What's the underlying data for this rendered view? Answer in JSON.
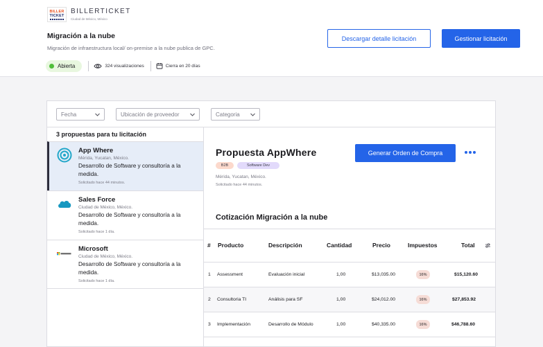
{
  "brand": {
    "logo_line1": "BILLER",
    "logo_line2": "TICKET",
    "name": "BILLERTICKET",
    "location": "Ciudad de México, México"
  },
  "header": {
    "title": "Migración a la nube",
    "subtitle": "Migración de infraestructura local/ on-premise a la nube publica de GPC.",
    "status": "Abierta",
    "views": "324 visualizaciones",
    "closes": "Cierra en 20 días",
    "download_label": "Descargar detalle licitación",
    "manage_label": "Gestionar licitación"
  },
  "colors": {
    "accent": "#2464e8",
    "status_green": "#4fbe3a",
    "selected_bg": "#e6edf8"
  },
  "filters": [
    {
      "label": "Fecha",
      "icon": "chevron-down-icon"
    },
    {
      "label": "Ubicación de proveedor",
      "icon": "chevron-down-icon"
    },
    {
      "label": "Categoria",
      "icon": "chevron-down-icon"
    }
  ],
  "proposals": {
    "title": "3 propuestas para tu licitación",
    "items": [
      {
        "name": "App Where",
        "location": "Mérida, Yucatan, México.",
        "description": "Desarrollo de Software y consultoría a la medida.",
        "requested": "Solicitado hace 44 minutos.",
        "icon": "appwhere-logo",
        "selected": true
      },
      {
        "name": "Sales Force",
        "location": "Ciudad de México, México.",
        "description": "Desarrollo de Software y consultoría a la medida.",
        "requested": "Solicitado hace 1 día.",
        "icon": "salesforce-logo",
        "selected": false
      },
      {
        "name": "Microsoft",
        "location": "Ciudad de México, México.",
        "description": "Desarrollo de Software y consultoría a la medida.",
        "requested": "Solicitado hace 1 día.",
        "icon": "microsoft-logo",
        "selected": false
      }
    ]
  },
  "detail": {
    "title": "Propuesta AppWhere",
    "tags": [
      "B2B",
      "Software Dev"
    ],
    "location": "Mérida, Yucatan, México.",
    "requested": "Solicitado hace 44 minutos.",
    "order_label": "Generar Orden de Compra",
    "quote_title": "Cotización Migración a la nube"
  },
  "table": {
    "headers": [
      "#",
      "Producto",
      "Descripción",
      "Cantidad",
      "Precio",
      "Impuestos",
      "Total"
    ],
    "rows": [
      [
        "1",
        "Assessment",
        "Evaluación inicial",
        "1,00",
        "$13,035.00",
        "16%",
        "$15,120.60"
      ],
      [
        "2",
        "Consultoria TI",
        "Análisis para SF",
        "1,00",
        "$24,012.00",
        "16%",
        "$27,853.92"
      ],
      [
        "3",
        "Implementación",
        "Desarrollo de Módulo",
        "1,00",
        "$40,335.00",
        "16%",
        "$46,788.60"
      ]
    ]
  }
}
